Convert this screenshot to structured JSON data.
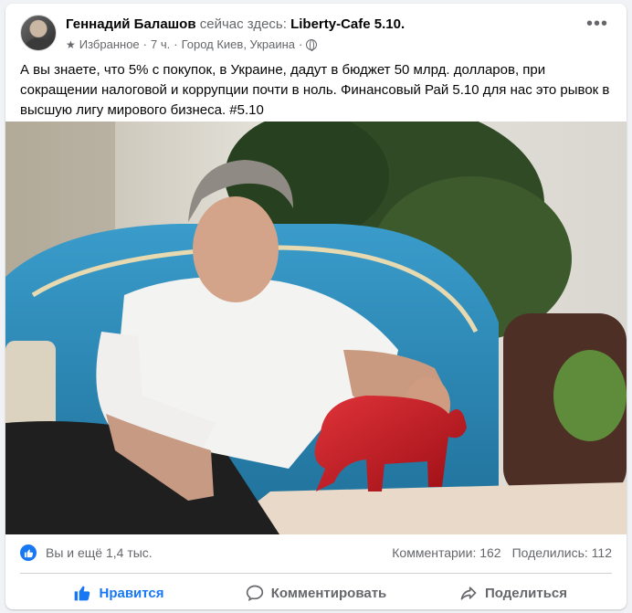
{
  "post": {
    "author": "Геннадий Балашов",
    "checkin_text": "сейчас здесь:",
    "place": "Liberty-Cafe 5.10.",
    "favorites": "Избранное",
    "time": "7 ч.",
    "location": "Город Киев, Украина",
    "text": "А вы знаете, что 5% с покупок, в Украине, дадут в бюджет 50 млрд. долларов, при сокращении налоговой и коррупции почти в ноль. Финансовый Рай 5.10 для нас это рывок в высшую лигу мирового бизнеса. #5.10"
  },
  "reactions": {
    "summary": "Вы и ещё 1,4 тыс.",
    "comments": "Комментарии: 162",
    "shares": "Поделились: 112"
  },
  "actions": {
    "like": "Нравится",
    "comment": "Комментировать",
    "share": "Поделиться"
  },
  "colors": {
    "accent": "#1877f2",
    "secondary_text": "#65676b",
    "armchair": "#2a86b3",
    "bull": "#c0181f"
  },
  "icons": {
    "more": "more-options-icon",
    "star": "star-icon",
    "globe": "globe-icon",
    "like": "thumbs-up-icon",
    "comment": "speech-bubble-icon",
    "share": "share-arrow-icon"
  }
}
